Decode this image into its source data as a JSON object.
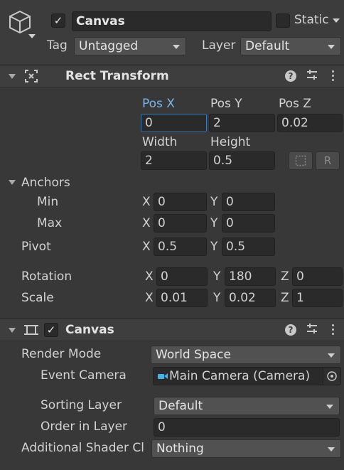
{
  "object": {
    "name": "Canvas",
    "static_label": "Static",
    "tag_label": "Tag",
    "tag_value": "Untagged",
    "layer_label": "Layer",
    "layer_value": "Default"
  },
  "rect_transform": {
    "title": "Rect Transform",
    "pos_x_label": "Pos X",
    "pos_y_label": "Pos Y",
    "pos_z_label": "Pos Z",
    "pos_x": "0",
    "pos_y": "2",
    "pos_z": "0.02",
    "width_label": "Width",
    "height_label": "Height",
    "width": "2",
    "height": "0.5",
    "raw_edit_label": "R",
    "anchors_label": "Anchors",
    "min_label": "Min",
    "min_x": "0",
    "min_y": "0",
    "max_label": "Max",
    "max_x": "0",
    "max_y": "0",
    "pivot_label": "Pivot",
    "pivot_x": "0.5",
    "pivot_y": "0.5",
    "rotation_label": "Rotation",
    "rot_x": "0",
    "rot_y": "180",
    "rot_z": "0",
    "scale_label": "Scale",
    "scale_x": "0.01",
    "scale_y": "0.02",
    "scale_z": "1",
    "axis_x": "X",
    "axis_y": "Y",
    "axis_z": "Z"
  },
  "canvas": {
    "title": "Canvas",
    "render_mode_label": "Render Mode",
    "render_mode": "World Space",
    "event_camera_label": "Event Camera",
    "event_camera": "Main Camera (Camera)",
    "sorting_layer_label": "Sorting Layer",
    "sorting_layer": "Default",
    "order_label": "Order in Layer",
    "order": "0",
    "shader_label": "Additional Shader Cl",
    "shader": "Nothing"
  },
  "colors": {
    "background": "#383838",
    "header": "#3e3e3e",
    "field": "#2a2a2a",
    "accent": "#7ab4e8"
  }
}
